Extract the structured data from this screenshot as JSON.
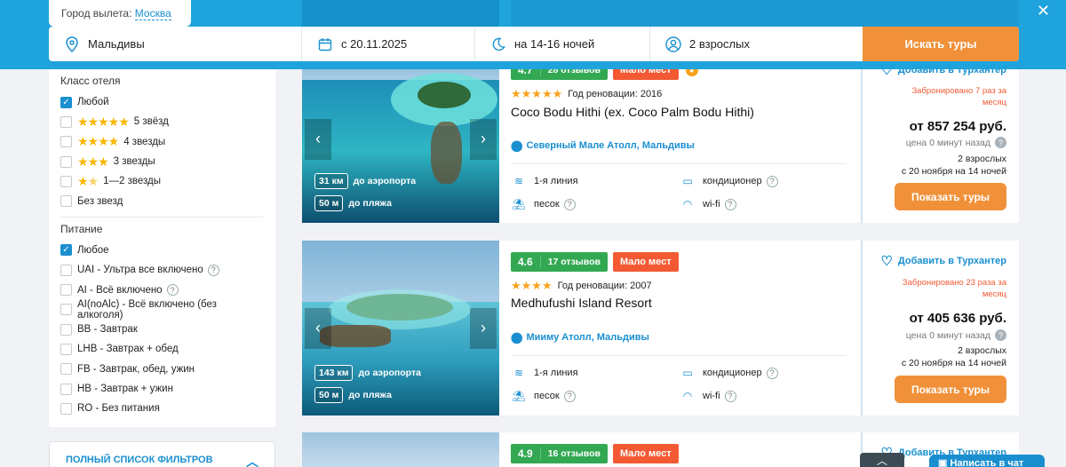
{
  "header": {
    "departure_label": "Город вылета:",
    "departure_city": "Москва",
    "destination": "Мальдивы",
    "date": "с 20.11.2025",
    "nights": "на 14-16 ночей",
    "tourists": "2 взрослых",
    "search_button": "Искать туры"
  },
  "filters": {
    "hotel_class_title": "Класс отеля",
    "hotel_class": [
      {
        "label": "Любой",
        "checked": true,
        "stars": 0
      },
      {
        "label": "5 звёзд",
        "checked": false,
        "stars": 5
      },
      {
        "label": "4 звезды",
        "checked": false,
        "stars": 4
      },
      {
        "label": "3 звезды",
        "checked": false,
        "stars": 3
      },
      {
        "label": "1—2 звезды",
        "checked": false,
        "stars": 2
      },
      {
        "label": "Без звезд",
        "checked": false,
        "stars": 0
      }
    ],
    "meal_title": "Питание",
    "meals": [
      {
        "label": "Любое",
        "checked": true,
        "help": false
      },
      {
        "label": "UAI - Ультра все включено",
        "checked": false,
        "help": true
      },
      {
        "label": "AI - Всё включено",
        "checked": false,
        "help": true
      },
      {
        "label": "AI(noAlc) - Всё включено (без алкоголя)",
        "checked": false,
        "help": false
      },
      {
        "label": "BB - Завтрак",
        "checked": false,
        "help": false
      },
      {
        "label": "LHB - Завтрак + обед",
        "checked": false,
        "help": false
      },
      {
        "label": "FB - Завтрак, обед, ужин",
        "checked": false,
        "help": false
      },
      {
        "label": "HB - Завтрак + ужин",
        "checked": false,
        "help": false
      },
      {
        "label": "RO - Без питания",
        "checked": false,
        "help": false
      }
    ],
    "full_list_label": "ПОЛНЫЙ СПИСОК ФИЛЬТРОВ"
  },
  "hotels": [
    {
      "score": "4.7",
      "reviews": "28 отзывов",
      "badge": "Мало мест",
      "stars": 5,
      "renovation": "Год реновации: 2016",
      "name": "Coco Bodu Hithi (ex. Coco Palm Bodu Hithi)",
      "location": "Северный Мале Атолл, Мальдивы",
      "airport_dist": "31 км",
      "airport_label": "до аэропорта",
      "beach_dist": "50 м",
      "beach_label": "до пляжа",
      "amenities": [
        "1-я линия",
        "кондиционер",
        "песок",
        "wi-fi"
      ],
      "add_label": "Добавить в Турхантер",
      "booked": "Забронировано 7 раз за месяц",
      "price": "от 857 254 руб.",
      "price_note": "цена 0 минут назад",
      "pax": "2 взрослых",
      "dates": "с 20 ноября на 14 ночей",
      "button": "Показать туры"
    },
    {
      "score": "4.6",
      "reviews": "17 отзывов",
      "badge": "Мало мест",
      "stars": 4,
      "renovation": "Год реновации: 2007",
      "name": "Medhufushi Island Resort",
      "location": "Мииму Атолл, Мальдивы",
      "airport_dist": "143 км",
      "airport_label": "до аэропорта",
      "beach_dist": "50 м",
      "beach_label": "до пляжа",
      "amenities": [
        "1-я линия",
        "кондиционер",
        "песок",
        "wi-fi"
      ],
      "add_label": "Добавить в Турхантер",
      "booked": "Забронировано 23 раза за месяц",
      "price": "от 405 636 руб.",
      "price_note": "цена 0 минут назад",
      "pax": "2 взрослых",
      "dates": "с 20 ноября на 14 ночей",
      "button": "Показать туры"
    },
    {
      "score": "4.9",
      "reviews": "16 отзывов",
      "badge": "Мало мест",
      "add_label": "Добавить в Турхантер"
    }
  ],
  "floating": {
    "chat_label": "Написать в чат"
  }
}
